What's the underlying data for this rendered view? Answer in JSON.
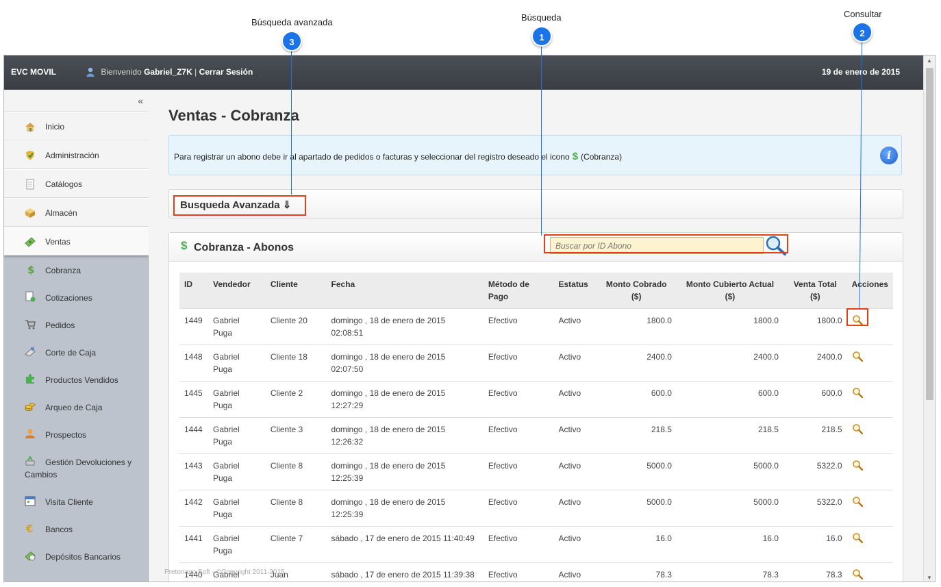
{
  "callouts": [
    {
      "label": "Búsqueda avanzada",
      "num": "3"
    },
    {
      "label": "Búsqueda",
      "num": "1"
    },
    {
      "label": "Consultar",
      "num": "2"
    }
  ],
  "topbar": {
    "brand": "EVC MOVIL",
    "welcome_prefix": "Bienvenido",
    "user": "Gabriel_Z7K",
    "separator": "|",
    "logout": "Cerrar Sesión",
    "date": "19 de enero de 2015"
  },
  "sidebar": {
    "collapse": "«",
    "main_items": [
      {
        "label": "Inicio",
        "icon": "home-icon"
      },
      {
        "label": "Administración",
        "icon": "admin-icon"
      },
      {
        "label": "Catálogos",
        "icon": "document-icon"
      },
      {
        "label": "Almacén",
        "icon": "box-icon"
      },
      {
        "label": "Ventas",
        "icon": "money-icon"
      }
    ],
    "sub_items": [
      {
        "label": "Cobranza",
        "icon": "dollar-icon"
      },
      {
        "label": "Cotizaciones",
        "icon": "quote-icon"
      },
      {
        "label": "Pedidos",
        "icon": "cart-icon"
      },
      {
        "label": "Corte de Caja",
        "icon": "register-icon"
      },
      {
        "label": "Productos Vendidos",
        "icon": "puzzle-icon"
      },
      {
        "label": "Arqueo de Caja",
        "icon": "coins-icon"
      },
      {
        "label": "Prospectos",
        "icon": "person-icon"
      },
      {
        "label": "Gestión Devoluciones y Cambios",
        "icon": "return-icon"
      },
      {
        "label": "Visita Cliente",
        "icon": "calendar-icon"
      },
      {
        "label": "Bancos",
        "icon": "euro-icon"
      },
      {
        "label": "Depósitos Bancarios",
        "icon": "deposit-icon"
      }
    ]
  },
  "main": {
    "title": "Ventas - Cobranza",
    "info_text_1": "Para registrar un abono debe ir al apartado de pedidos o facturas y seleccionar del registro deseado el icono",
    "info_dollar": "$",
    "info_text_2": "(Cobranza)",
    "advanced_search": "Busqueda Avanzada ⇓",
    "panel_dollar": "$",
    "panel_title": "Cobranza - Abonos",
    "search_placeholder": "Buscar por ID Abono",
    "footer": "Pretoriano Soft - ©Copyright 2011-2015"
  },
  "table": {
    "headers": {
      "id": "ID",
      "vendedor": "Vendedor",
      "cliente": "Cliente",
      "fecha": "Fecha",
      "metodo": "Método de Pago",
      "estatus": "Estatus",
      "monto": "Monto Cobrado ($)",
      "cubierto": "Monto Cubierto Actual ($)",
      "total": "Venta Total ($)",
      "acciones": "Acciones"
    },
    "rows": [
      {
        "id": "1449",
        "vendedor": "Gabriel Puga",
        "cliente": "Cliente 20",
        "fecha": "domingo , 18 de enero de 2015 02:08:51",
        "metodo": "Efectivo",
        "estatus": "Activo",
        "monto": "1800.0",
        "cubierto": "1800.0",
        "total": "1800.0"
      },
      {
        "id": "1448",
        "vendedor": "Gabriel Puga",
        "cliente": "Cliente 18",
        "fecha": "domingo , 18 de enero de 2015 02:07:50",
        "metodo": "Efectivo",
        "estatus": "Activo",
        "monto": "2400.0",
        "cubierto": "2400.0",
        "total": "2400.0"
      },
      {
        "id": "1445",
        "vendedor": "Gabriel Puga",
        "cliente": "Cliente 2",
        "fecha": "domingo , 18 de enero de 2015 12:27:29",
        "metodo": "Efectivo",
        "estatus": "Activo",
        "monto": "600.0",
        "cubierto": "600.0",
        "total": "600.0"
      },
      {
        "id": "1444",
        "vendedor": "Gabriel Puga",
        "cliente": "Cliente 3",
        "fecha": "domingo , 18 de enero de 2015 12:26:32",
        "metodo": "Efectivo",
        "estatus": "Activo",
        "monto": "218.5",
        "cubierto": "218.5",
        "total": "218.5"
      },
      {
        "id": "1443",
        "vendedor": "Gabriel Puga",
        "cliente": "Cliente 8",
        "fecha": "domingo , 18 de enero de 2015 12:25:39",
        "metodo": "Efectivo",
        "estatus": "Activo",
        "monto": "5000.0",
        "cubierto": "5000.0",
        "total": "5322.0"
      },
      {
        "id": "1442",
        "vendedor": "Gabriel Puga",
        "cliente": "Cliente 8",
        "fecha": "domingo , 18 de enero de 2015 12:25:39",
        "metodo": "Efectivo",
        "estatus": "Activo",
        "monto": "5000.0",
        "cubierto": "5000.0",
        "total": "5322.0"
      },
      {
        "id": "1441",
        "vendedor": "Gabriel Puga",
        "cliente": "Cliente 7",
        "fecha": "sábado , 17 de enero de 2015 11:40:49",
        "metodo": "Efectivo",
        "estatus": "Activo",
        "monto": "16.0",
        "cubierto": "16.0",
        "total": "16.0"
      },
      {
        "id": "1440",
        "vendedor": "Gabriel Puga",
        "cliente": "Juan Martinez",
        "fecha": "sábado , 17 de enero de 2015 11:39:38",
        "metodo": "Efectivo",
        "estatus": "Activo",
        "monto": "78.3",
        "cubierto": "78.3",
        "total": "78.3"
      }
    ]
  },
  "colors": {
    "accent": "#1a73e8",
    "highlight": "#e0401a",
    "topbar": "#3f444a",
    "sidebar": "#bcc3cc",
    "info_bg": "#e8f4fb"
  }
}
